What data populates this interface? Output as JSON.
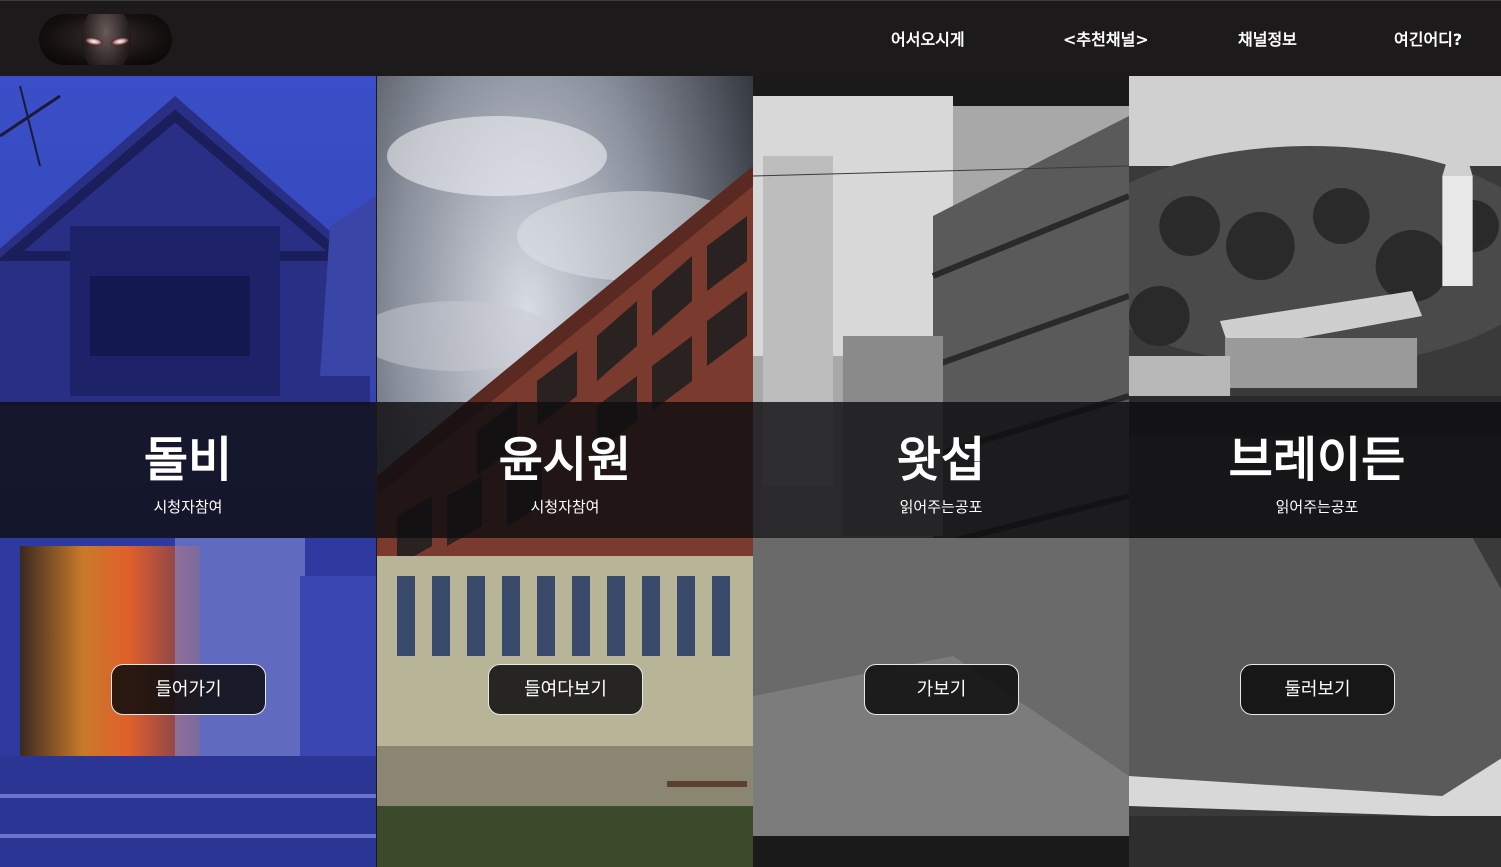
{
  "header": {
    "logo_icon": "horror-face-logo",
    "nav": [
      {
        "label": "어서오시게"
      },
      {
        "label": "<추천채널>"
      },
      {
        "label": "채널정보"
      },
      {
        "label": "여긴어디?"
      }
    ]
  },
  "panels": [
    {
      "title": "돌비",
      "subtitle": "시청자참여",
      "button": "들어가기"
    },
    {
      "title": "윤시원",
      "subtitle": "시청자참여",
      "button": "들여다보기"
    },
    {
      "title": "왓섭",
      "subtitle": "읽어주는공포",
      "button": "가보기"
    },
    {
      "title": "브레이든",
      "subtitle": "읽어주는공포",
      "button": "둘러보기"
    }
  ],
  "colors": {
    "header_bg": "#1c1a1a",
    "band_bg": "#0f0e10",
    "text": "#ffffff"
  }
}
